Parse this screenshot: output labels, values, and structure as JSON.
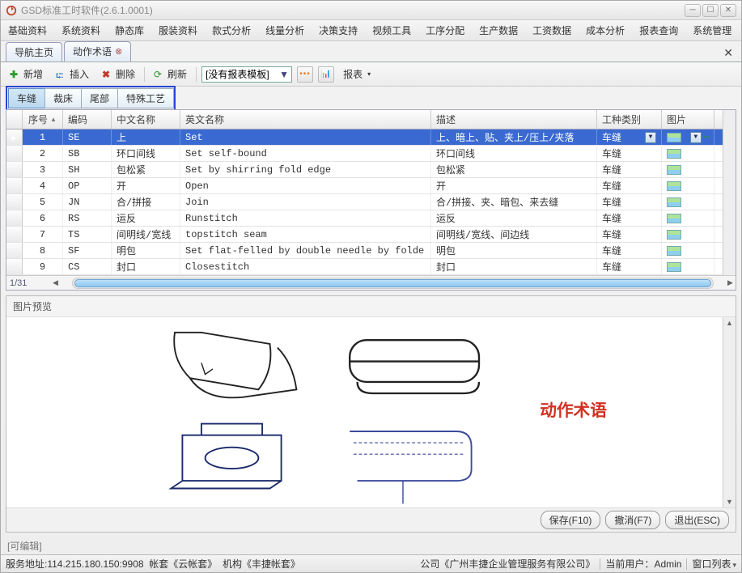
{
  "window": {
    "title": "GSD标准工时软件(2.6.1.0001)"
  },
  "menubar": [
    "基础资料",
    "系统资料",
    "静态库",
    "服装资料",
    "款式分析",
    "线量分析",
    "决策支持",
    "视频工具",
    "工序分配",
    "生产数据",
    "工资数据",
    "成本分析",
    "报表查询",
    "系统管理"
  ],
  "page_tabs": {
    "home": "导航主页",
    "active": "动作术语"
  },
  "toolbar": {
    "add": "新增",
    "insert": "插入",
    "delete": "删除",
    "refresh": "刷新",
    "template_placeholder": "[没有报表模板]",
    "report": "报表"
  },
  "category_tabs": {
    "items": [
      "车缝",
      "裁床",
      "尾部",
      "特殊工艺"
    ],
    "active_index": 0
  },
  "grid": {
    "headers": {
      "seq": "序号",
      "code": "编码",
      "cn": "中文名称",
      "en": "英文名称",
      "desc": "描述",
      "type": "工种类别",
      "img": "图片"
    },
    "rows": [
      {
        "seq": "1",
        "code": "SE",
        "cn": "上",
        "en": "Set",
        "desc": "上、暗上、贴、夹上/压上/夹落",
        "type": "车缝"
      },
      {
        "seq": "2",
        "code": "SB",
        "cn": "环口间线",
        "en": "Set self-bound",
        "desc": "环口间线",
        "type": "车缝"
      },
      {
        "seq": "3",
        "code": "SH",
        "cn": "包松紧",
        "en": "Set by shirring fold edge",
        "desc": "包松紧",
        "type": "车缝"
      },
      {
        "seq": "4",
        "code": "OP",
        "cn": "开",
        "en": "Open",
        "desc": "开",
        "type": "车缝"
      },
      {
        "seq": "5",
        "code": "JN",
        "cn": "合/拼接",
        "en": "Join",
        "desc": "合/拼接、夹、暗包、来去缝",
        "type": "车缝"
      },
      {
        "seq": "6",
        "code": "RS",
        "cn": "运反",
        "en": "Runstitch",
        "desc": "运反",
        "type": "车缝"
      },
      {
        "seq": "7",
        "code": "TS",
        "cn": "间明线/宽线",
        "en": "topstitch seam",
        "desc": "间明线/宽线、间边线",
        "type": "车缝"
      },
      {
        "seq": "8",
        "code": "SF",
        "cn": "明包",
        "en": "Set flat-felled by double needle by folde",
        "desc": "明包",
        "type": "车缝"
      },
      {
        "seq": "9",
        "code": "CS",
        "cn": "封口",
        "en": "Closestitch",
        "desc": "封口",
        "type": "车缝"
      }
    ],
    "page_indicator": "1/31",
    "selected_index": 0
  },
  "preview": {
    "title": "图片预览",
    "caption": "动作术语"
  },
  "action_buttons": {
    "save": "保存(F10)",
    "undo": "撤消(F7)",
    "exit": "退出(ESC)"
  },
  "edit_mode": "[可编辑]",
  "statusbar": {
    "addr_label": "服务地址:",
    "addr": "114.215.180.150:9908",
    "acct_label": "帐套",
    "acct": "《云帐套》",
    "org_label": "机构",
    "org": "《丰捷帐套》",
    "company_label": "公司",
    "company": "《广州丰捷企业管理服务有限公司》",
    "user_label": "当前用户：",
    "user": "Admin",
    "winlist": "窗口列表"
  }
}
